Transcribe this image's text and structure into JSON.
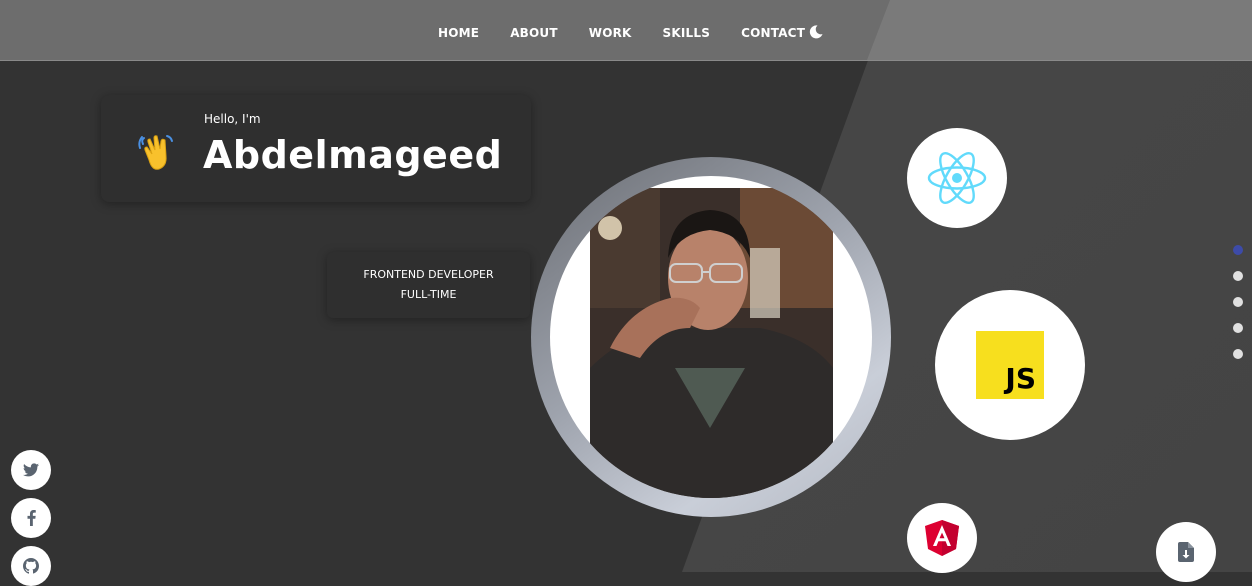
{
  "nav": {
    "items": [
      {
        "label": "HOME"
      },
      {
        "label": "ABOUT"
      },
      {
        "label": "WORK"
      },
      {
        "label": "SKILLS"
      },
      {
        "label": "CONTACT"
      }
    ],
    "theme_toggle_icon": "moon-icon"
  },
  "hero": {
    "greeting": "Hello, I'm",
    "name": "Abdelmageed",
    "greeting_icon": "waving-hand-icon",
    "role_line1": "FRONTEND DEVELOPER",
    "role_line2": "FULL-TIME",
    "photo_icon": "profile-photo"
  },
  "tech_icons": [
    "react-icon",
    "javascript-icon",
    "angular-icon"
  ],
  "javascript_badge": "JS",
  "section_dots": {
    "count": 5,
    "active_index": 0
  },
  "social": [
    "twitter-icon",
    "facebook-icon",
    "github-icon"
  ],
  "download_icon": "download-file-icon",
  "colors": {
    "background": "#333333",
    "navbar": "#6d6d6d",
    "active_dot": "#3d4ba8",
    "javascript_yellow": "#f7df1e",
    "angular_red": "#dd0031",
    "react_blue": "#61dafb"
  }
}
